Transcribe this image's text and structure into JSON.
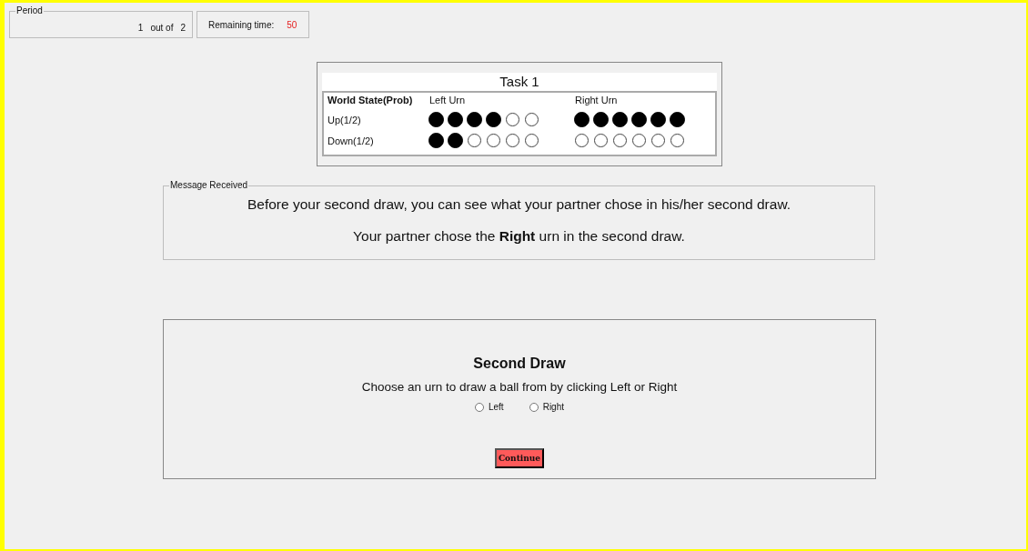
{
  "period": {
    "legend": "Period",
    "current": "1",
    "separator": "out of",
    "total": "2"
  },
  "timer": {
    "label": "Remaining time:",
    "value": "50"
  },
  "task": {
    "title": "Task 1",
    "columns": [
      "World State(Prob)",
      "Left Urn",
      "Right Urn"
    ],
    "rows": [
      {
        "state": "Up(1/2)",
        "left": [
          true,
          true,
          true,
          true,
          false,
          false
        ],
        "right": [
          true,
          true,
          true,
          true,
          true,
          true
        ]
      },
      {
        "state": "Down(1/2)",
        "left": [
          true,
          true,
          false,
          false,
          false,
          false
        ],
        "right": [
          false,
          false,
          false,
          false,
          false,
          false
        ]
      }
    ]
  },
  "message": {
    "legend": "Message Received",
    "lines": [
      "Before your second draw, you can see what your partner chose in his/her second draw.",
      "Your partner chose the **Right** urn in the second draw."
    ]
  },
  "draw": {
    "title": "Second Draw",
    "instruction": "Choose an urn to draw a ball from by clicking Left or Right",
    "options": [
      {
        "label": "Left",
        "selected": false
      },
      {
        "label": "Right",
        "selected": false
      }
    ],
    "button": "Continue"
  }
}
